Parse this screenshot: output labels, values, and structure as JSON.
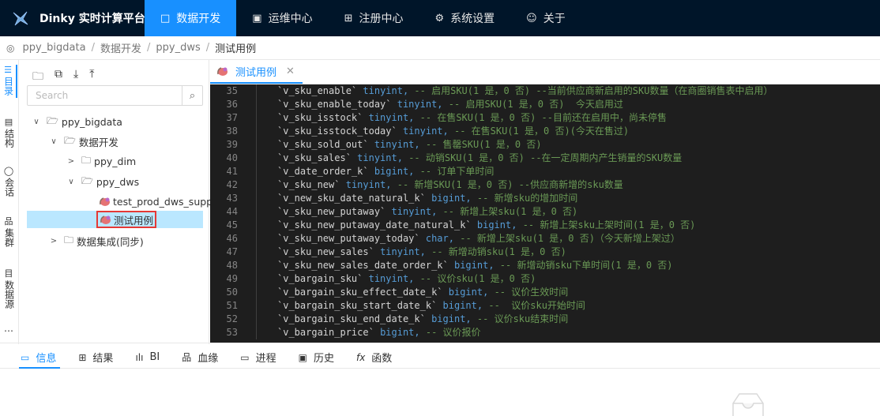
{
  "header": {
    "brand": "Dinky 实时计算平台",
    "nav": [
      {
        "icon": "□",
        "label": "数据开发",
        "active": true
      },
      {
        "icon": "▣",
        "label": "运维中心",
        "active": false
      },
      {
        "icon": "⊞",
        "label": "注册中心",
        "active": false
      },
      {
        "icon": "⚙",
        "label": "系统设置",
        "active": false
      },
      {
        "icon": "☺",
        "label": "关于",
        "active": false
      }
    ]
  },
  "breadcrumb": [
    "ppy_bigdata",
    "数据开发",
    "ppy_dws",
    "测试用例"
  ],
  "vtabs": [
    {
      "icon": "☰",
      "label": "目录"
    },
    {
      "icon": "▤",
      "label": "结构"
    },
    {
      "icon": "◯",
      "label": "会话"
    },
    {
      "icon": "品",
      "label": "集群"
    },
    {
      "icon": "目",
      "label": "数据源"
    },
    {
      "icon": "",
      "label": "…"
    }
  ],
  "tree": {
    "search_placeholder": "Search",
    "nodes": [
      {
        "arrow": "∨",
        "folder": "🗁",
        "label": "ppy_bigdata"
      },
      {
        "arrow": "∨",
        "folder": "🗁",
        "label": "数据开发"
      },
      {
        "arrow": ">",
        "folder": "🗀",
        "label": "ppy_dim"
      },
      {
        "arrow": "∨",
        "folder": "🗁",
        "label": "ppy_dws"
      },
      {
        "arrow": "",
        "folder": "",
        "label": "test_prod_dws_supp"
      },
      {
        "arrow": "",
        "folder": "",
        "label": "测试用例"
      },
      {
        "arrow": ">",
        "folder": "🗀",
        "label": "数据集成(同步)"
      }
    ]
  },
  "editor": {
    "tab_label": "测试用例",
    "lines": [
      {
        "n": "35",
        "col": "`v_sku_enable`",
        "type": "tinyint,",
        "comment": "-- 启用SKU(1 是，0 否) --当前供应商新启用的SKU数量（在商圈销售表中启用）"
      },
      {
        "n": "36",
        "col": "`v_sku_enable_today`",
        "type": "tinyint,",
        "comment": "-- 启用SKU(1 是，0 否)  今天启用过"
      },
      {
        "n": "37",
        "col": "`v_sku_isstock`",
        "type": "tinyint,",
        "comment": "-- 在售SKU(1 是，0 否) --目前还在启用中，尚未停售"
      },
      {
        "n": "38",
        "col": "`v_sku_isstock_today`",
        "type": "tinyint,",
        "comment": "-- 在售SKU(1 是，0 否)(今天在售过)"
      },
      {
        "n": "39",
        "col": "`v_sku_sold_out`",
        "type": "tinyint,",
        "comment": "-- 售罄SKU(1 是，0 否)"
      },
      {
        "n": "40",
        "col": "`v_sku_sales`",
        "type": "tinyint,",
        "comment": "-- 动销SKU(1 是，0 否) --在一定周期内产生销量的SKU数量"
      },
      {
        "n": "41",
        "col": "`v_date_order_k`",
        "type": "bigint,",
        "comment": "-- 订单下单时间"
      },
      {
        "n": "42",
        "col": "`v_sku_new`",
        "type": "tinyint,",
        "comment": "-- 新增SKU(1 是，0 否) --供应商新增的sku数量"
      },
      {
        "n": "43",
        "col": "`v_new_sku_date_natural_k`",
        "type": "bigint,",
        "comment": "-- 新增sku的增加时间"
      },
      {
        "n": "44",
        "col": "`v_sku_new_putaway`",
        "type": "tinyint,",
        "comment": "-- 新增上架sku(1 是，0 否)"
      },
      {
        "n": "45",
        "col": "`v_sku_new_putaway_date_natural_k`",
        "type": "bigint,",
        "comment": "-- 新增上架sku上架时间(1 是，0 否)"
      },
      {
        "n": "46",
        "col": "`v_sku_new_putaway_today`",
        "type": "char,",
        "comment": "-- 新增上架sku(1 是，0 否)（今天新增上架过）"
      },
      {
        "n": "47",
        "col": "`v_sku_new_sales`",
        "type": "tinyint,",
        "comment": "-- 新增动销sku(1 是，0 否)"
      },
      {
        "n": "48",
        "col": "`v_sku_new_sales_date_order_k`",
        "type": "bigint,",
        "comment": "-- 新增动销sku下单时间(1 是，0 否)"
      },
      {
        "n": "49",
        "col": "`v_bargain_sku`",
        "type": "tinyint,",
        "comment": "-- 议价sku(1 是，0 否)"
      },
      {
        "n": "50",
        "col": "`v_bargain_sku_effect_date_k`",
        "type": "bigint,",
        "comment": "-- 议价生效时间"
      },
      {
        "n": "51",
        "col": "`v_bargain_sku_start_date_k`",
        "type": "bigint,",
        "comment": "--  议价sku开始时间"
      },
      {
        "n": "52",
        "col": "`v_bargain_sku_end_date_k`",
        "type": "bigint,",
        "comment": "-- 议价sku结束时间"
      },
      {
        "n": "53",
        "col": "`v_bargain_price`",
        "type": "bigint,",
        "comment": "-- 议价报价"
      }
    ]
  },
  "bottom_tabs": [
    {
      "icon": "▭",
      "label": "信息",
      "active": true
    },
    {
      "icon": "⊞",
      "label": "结果",
      "active": false
    },
    {
      "icon": "ılı",
      "label": "BI",
      "active": false
    },
    {
      "icon": "品",
      "label": "血缘",
      "active": false
    },
    {
      "icon": "▭",
      "label": "进程",
      "active": false
    },
    {
      "icon": "▣",
      "label": "历史",
      "active": false
    },
    {
      "icon": "fx",
      "label": "函数",
      "active": false
    }
  ],
  "colors": {
    "primary": "#1890ff",
    "header_bg": "#001529",
    "editor_bg": "#1e1e1e",
    "highlight_border": "#e53935"
  }
}
